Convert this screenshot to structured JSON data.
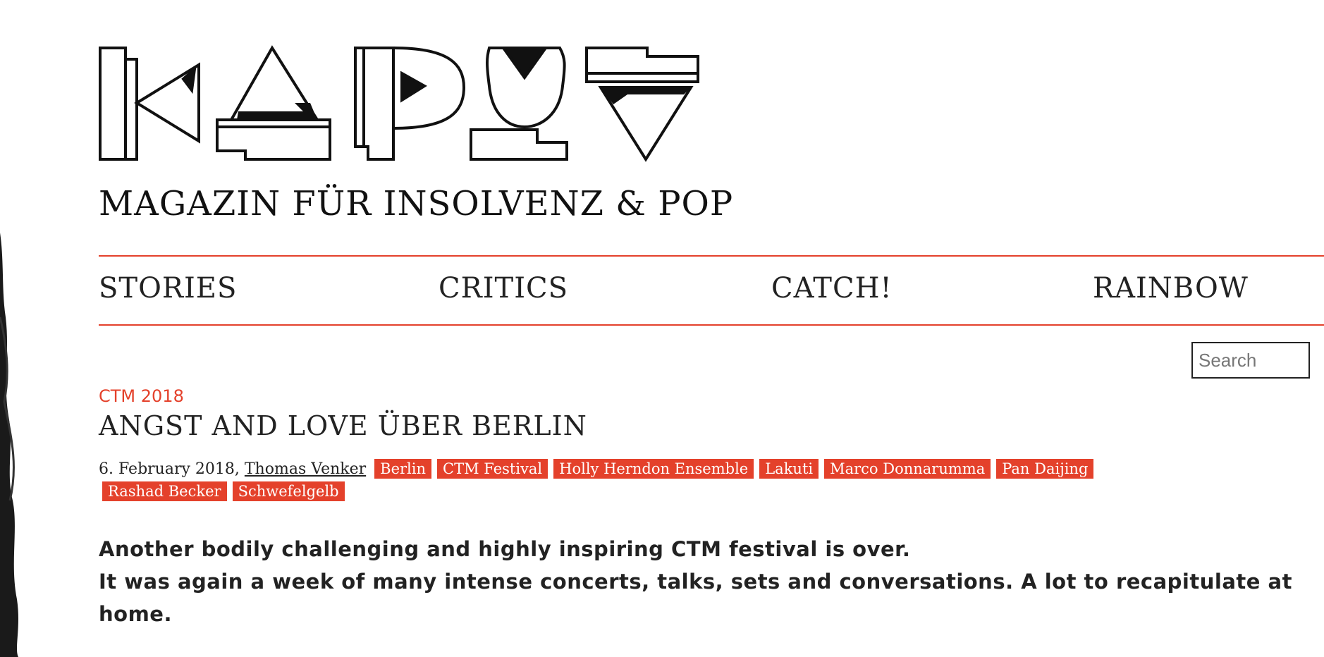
{
  "site": {
    "logo_text": "KAPUT",
    "tagline": "MAGAZIN FÜR INSOLVENZ & POP"
  },
  "nav": {
    "items": [
      {
        "label": "STORIES"
      },
      {
        "label": "CRITICS"
      },
      {
        "label": "CATCH!"
      },
      {
        "label": "RAINBOW"
      }
    ]
  },
  "search": {
    "placeholder": "Search"
  },
  "article": {
    "category": "CTM 2018",
    "title": "ANGST AND LOVE ÜBER BERLIN",
    "date": "6. February 2018,",
    "author": "Thomas Venker",
    "tags": [
      "Berlin",
      "CTM Festival",
      "Holly Herndon Ensemble",
      "Lakuti",
      "Marco Donnarumma",
      "Pan Daijing",
      "Rashad Becker",
      "Schwefelgelb"
    ],
    "intro_line1": "Another bodily challenging and highly inspiring CTM festival is over.",
    "intro_line2": "It was again a week of many intense concerts, talks, sets and conversations. A lot to recapitulate at home."
  },
  "colors": {
    "accent": "#e4412b",
    "text": "#222222",
    "background": "#ffffff"
  }
}
